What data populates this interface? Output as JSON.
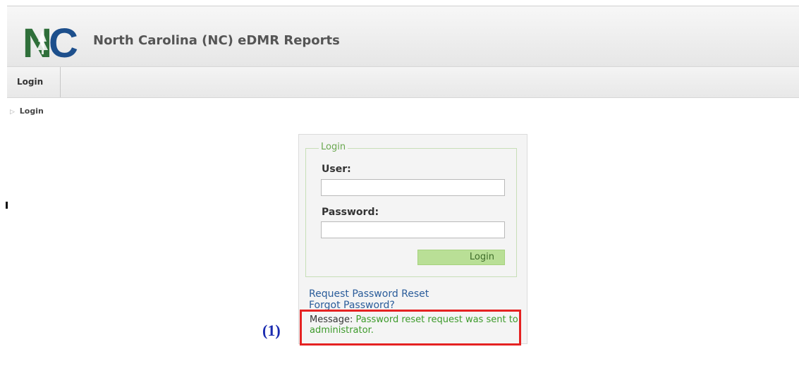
{
  "header": {
    "logo_text": "NC",
    "title": "North Carolina (NC) eDMR Reports"
  },
  "nav": {
    "tabs": [
      {
        "label": "Login"
      }
    ]
  },
  "breadcrumb": {
    "items": [
      "Login"
    ],
    "icon": "triangle-right-icon"
  },
  "login_form": {
    "legend": "Login",
    "user_label": "User:",
    "user_value": "",
    "password_label": "Password:",
    "password_value": "",
    "submit_label": "Login",
    "links": {
      "request_reset": "Request Password Reset",
      "forgot_password": "Forgot Password?"
    },
    "message": {
      "prefix": "Message:",
      "text": "Password reset request was sent to administrator."
    }
  },
  "annotation": {
    "label": "(1)",
    "color": "#e52222"
  },
  "colors": {
    "accent_green": "#6aa84f",
    "message_green": "#3c9a2a",
    "link_blue": "#2a5c9a",
    "annotation_blue": "#1a2bb0"
  }
}
